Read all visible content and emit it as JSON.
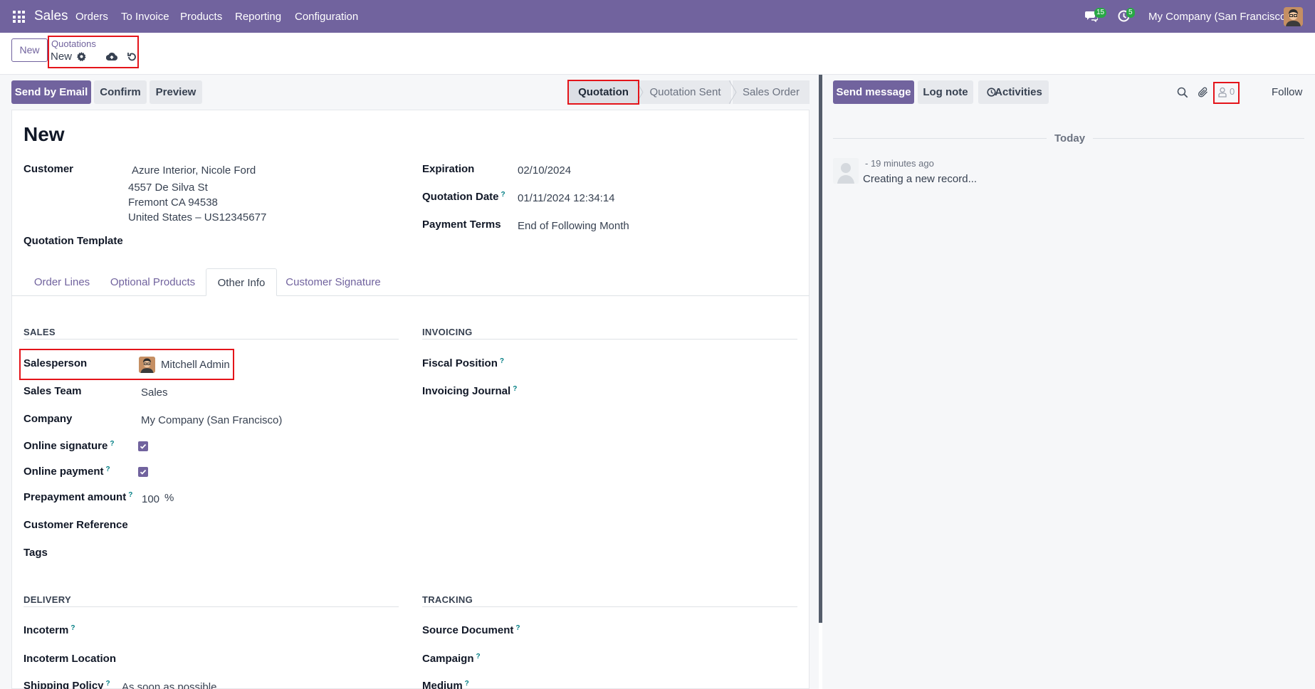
{
  "navbar": {
    "app_name": "Sales",
    "menu": [
      "Orders",
      "To Invoice",
      "Products",
      "Reporting",
      "Configuration"
    ],
    "messages_count": "15",
    "activities_count": "5",
    "company": "My Company (San Francisco)",
    "icons": [
      "apps-grid-icon",
      "chat-icon",
      "clock-icon"
    ]
  },
  "control": {
    "new_button": "New",
    "breadcrumb_parent": "Quotations",
    "breadcrumb_current": "New",
    "icons": [
      "gear-icon",
      "cloud-upload-icon",
      "undo-icon"
    ]
  },
  "actions": {
    "send_by_email": "Send by Email",
    "confirm": "Confirm",
    "preview": "Preview"
  },
  "statusbar": {
    "stages": [
      "Quotation",
      "Quotation Sent",
      "Sales Order"
    ],
    "active": "Quotation"
  },
  "form": {
    "title": "New",
    "customer_label": "Customer",
    "customer_name": "Azure Interior, Nicole Ford",
    "customer_address": [
      "4557 De Silva St",
      "Fremont CA 94538",
      "United States – US12345677"
    ],
    "quotation_template_label": "Quotation Template",
    "expiration_label": "Expiration",
    "expiration_value": "02/10/2024",
    "quotation_date_label": "Quotation Date",
    "quotation_date_value": "01/11/2024 12:34:14",
    "payment_terms_label": "Payment Terms",
    "payment_terms_value": "End of Following Month",
    "help_mark": "?"
  },
  "tabs": [
    "Order Lines",
    "Optional Products",
    "Other Info",
    "Customer Signature"
  ],
  "active_tab": "Other Info",
  "other_info": {
    "sales": {
      "title": "SALES",
      "salesperson_label": "Salesperson",
      "salesperson_value": "Mitchell Admin",
      "sales_team_label": "Sales Team",
      "sales_team_value": "Sales",
      "company_label": "Company",
      "company_value": "My Company (San Francisco)",
      "online_signature_label": "Online signature",
      "online_signature_checked": true,
      "online_payment_label": "Online payment",
      "online_payment_checked": true,
      "prepayment_label": "Prepayment amount",
      "prepayment_value": "100",
      "prepayment_unit": "%",
      "customer_reference_label": "Customer Reference",
      "tags_label": "Tags"
    },
    "invoicing": {
      "title": "INVOICING",
      "fiscal_position_label": "Fiscal Position",
      "invoicing_journal_label": "Invoicing Journal"
    },
    "delivery": {
      "title": "DELIVERY",
      "incoterm_label": "Incoterm",
      "incoterm_location_label": "Incoterm Location",
      "shipping_policy_label": "Shipping Policy",
      "shipping_policy_value": "As soon as possible"
    },
    "tracking": {
      "title": "TRACKING",
      "source_document_label": "Source Document",
      "campaign_label": "Campaign",
      "medium_label": "Medium"
    }
  },
  "chatter": {
    "send_message": "Send message",
    "log_note": "Log note",
    "activities": "Activities",
    "followers_count": "0",
    "follow": "Follow",
    "day_separator": "Today",
    "message_time": "- 19 minutes ago",
    "message_body": "Creating a new record..."
  }
}
